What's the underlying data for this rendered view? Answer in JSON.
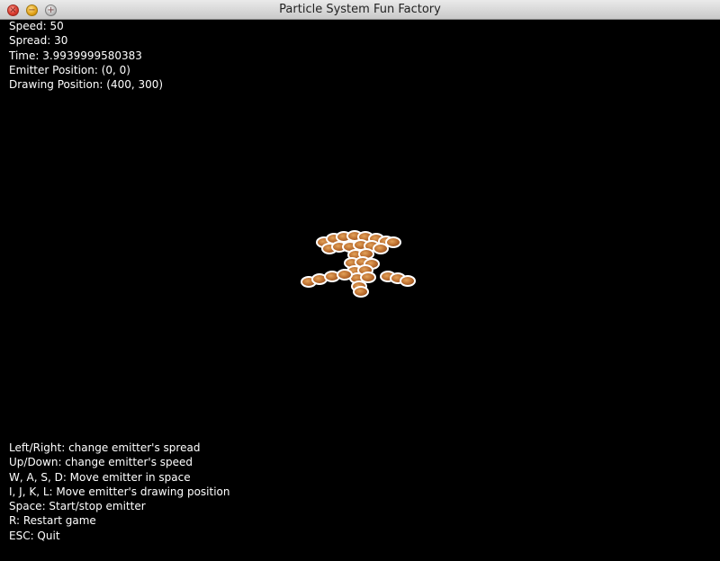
{
  "window": {
    "title": "Particle System Fun Factory",
    "close_glyph": "×",
    "min_glyph": "−",
    "max_glyph": "+"
  },
  "stats": {
    "speed": "Speed: 50",
    "spread": "Spread: 30",
    "time": "Time: 3.9939999580383",
    "emitter_position": "Emitter Position: (0, 0)",
    "drawing_position": "Drawing Position: (400, 300)"
  },
  "help": {
    "line1": "Left/Right: change emitter's spread",
    "line2": "Up/Down: change emitter's speed",
    "line3": "W, A, S, D: Move emitter in space",
    "line4": "I, J, K, L: Move emitter's drawing position",
    "line5": "Space: Start/stop emitter",
    "line6": "R: Restart game",
    "line7": "ESC: Quit"
  },
  "colors": {
    "background": "#000000",
    "hud_text": "#ffffff",
    "particle": "#b86a2c",
    "particle_outline": "#ffffff"
  }
}
